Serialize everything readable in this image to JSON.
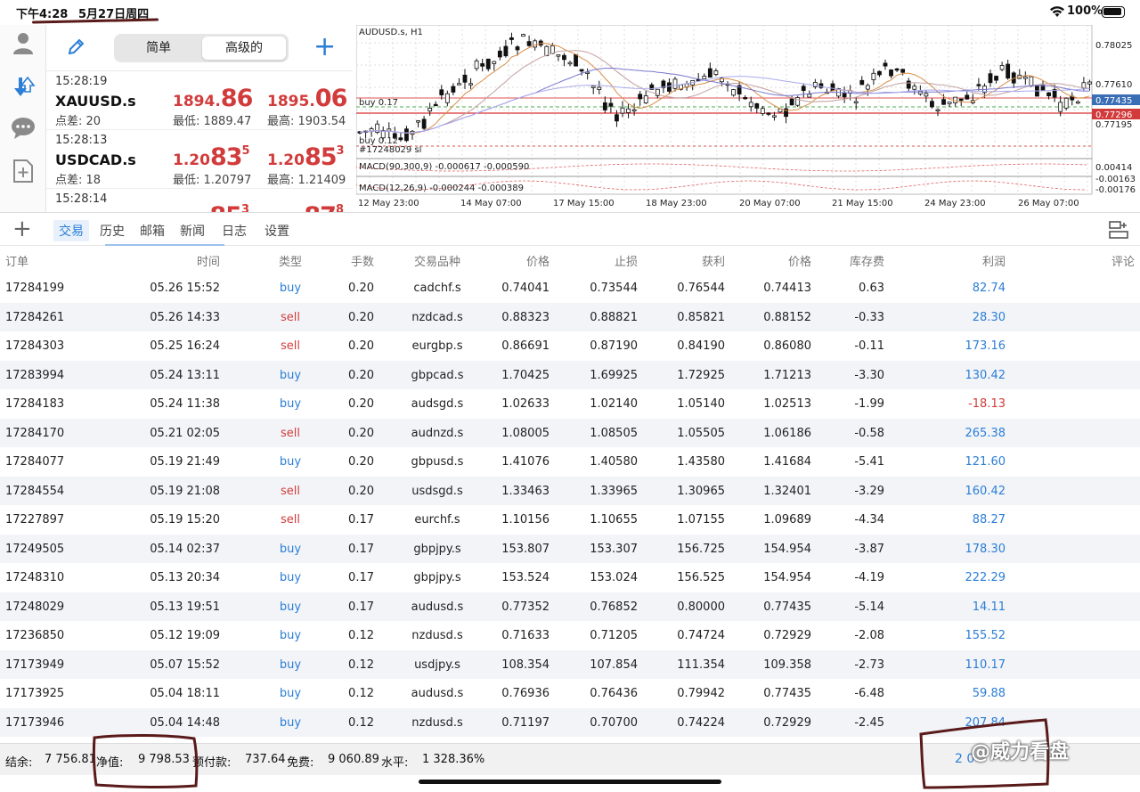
{
  "status": {
    "time": "下午4:28",
    "date": "5月27日周四",
    "battery": "100%"
  },
  "quotes_panel": {
    "segments": [
      "简单",
      "高级的"
    ],
    "active_segment": 1,
    "rows": [
      {
        "time": "15:28:19",
        "symbol": "XAUUSD.s",
        "spread": "点差: 20",
        "bid_pre": "1894.",
        "bid_big": "86",
        "bid_sup": "",
        "ask_pre": "1895.",
        "ask_big": "06",
        "ask_sup": "",
        "low": "最低: 1889.47",
        "high": "最高: 1903.54"
      },
      {
        "time": "15:28:13",
        "symbol": "USDCAD.s",
        "spread": "点差: 18",
        "bid_pre": "1.20",
        "bid_big": "83",
        "bid_sup": "5",
        "ask_pre": "1.20",
        "ask_big": "85",
        "ask_sup": "3",
        "low": "最低: 1.20797",
        "high": "最高: 1.21409"
      },
      {
        "time": "15:28:14",
        "symbol": "",
        "spread": "",
        "bid_pre": "",
        "bid_big": "85",
        "bid_sup": "3",
        "ask_pre": "",
        "ask_big": "87",
        "ask_sup": "8",
        "low": "",
        "high": ""
      }
    ]
  },
  "chart": {
    "symbol": "AUDUSD.s, H1",
    "price_labels": [
      "0.78025",
      "0.77610",
      "0.77435",
      "0.77296",
      "0.77195"
    ],
    "indicator_labels": [
      "0.00414",
      "-0.00163",
      "-0.00176"
    ],
    "time_labels": [
      "12 May 23:00",
      "14 May 07:00",
      "17 May 15:00",
      "18 May 23:00",
      "20 May 07:00",
      "21 May 15:00",
      "24 May 23:00",
      "26 May 07:00"
    ],
    "order_labels": [
      "buy 0.17",
      "buy 0.12",
      "#17248029 sl"
    ],
    "macd1": "MACD(90,300,9) -0.000617 -0.000590",
    "macd2": "MACD(12,26,9) -0.000244 -0.000389"
  },
  "tabs": [
    "交易",
    "历史",
    "邮箱",
    "新闻",
    "日志",
    "设置"
  ],
  "active_tab": 0,
  "table": {
    "headers": [
      "订单",
      "时间",
      "类型",
      "手数",
      "交易品种",
      "价格",
      "止损",
      "获利",
      "价格",
      "库存费",
      "利润",
      "评论"
    ],
    "rows": [
      [
        "17284199",
        "05.26 15:52",
        "buy",
        "0.20",
        "cadchf.s",
        "0.74041",
        "0.73544",
        "0.76544",
        "0.74413",
        "0.63",
        "82.74"
      ],
      [
        "17284261",
        "05.26 14:33",
        "sell",
        "0.20",
        "nzdcad.s",
        "0.88323",
        "0.88821",
        "0.85821",
        "0.88152",
        "-0.33",
        "28.30"
      ],
      [
        "17284303",
        "05.25 16:24",
        "sell",
        "0.20",
        "eurgbp.s",
        "0.86691",
        "0.87190",
        "0.84190",
        "0.86080",
        "-0.11",
        "173.16"
      ],
      [
        "17283994",
        "05.24 13:11",
        "buy",
        "0.20",
        "gbpcad.s",
        "1.70425",
        "1.69925",
        "1.72925",
        "1.71213",
        "-3.30",
        "130.42"
      ],
      [
        "17284183",
        "05.24 11:38",
        "buy",
        "0.20",
        "audsgd.s",
        "1.02633",
        "1.02140",
        "1.05140",
        "1.02513",
        "-1.99",
        "-18.13"
      ],
      [
        "17284170",
        "05.21 02:05",
        "sell",
        "0.20",
        "audnzd.s",
        "1.08005",
        "1.08505",
        "1.05505",
        "1.06186",
        "-0.58",
        "265.38"
      ],
      [
        "17284077",
        "05.19 21:49",
        "buy",
        "0.20",
        "gbpusd.s",
        "1.41076",
        "1.40580",
        "1.43580",
        "1.41684",
        "-5.41",
        "121.60"
      ],
      [
        "17284554",
        "05.19 21:08",
        "sell",
        "0.20",
        "usdsgd.s",
        "1.33463",
        "1.33965",
        "1.30965",
        "1.32401",
        "-3.29",
        "160.42"
      ],
      [
        "17227897",
        "05.19 15:20",
        "sell",
        "0.17",
        "eurchf.s",
        "1.10156",
        "1.10655",
        "1.07155",
        "1.09689",
        "-4.34",
        "88.27"
      ],
      [
        "17249505",
        "05.14 02:37",
        "buy",
        "0.17",
        "gbpjpy.s",
        "153.807",
        "153.307",
        "156.725",
        "154.954",
        "-3.87",
        "178.30"
      ],
      [
        "17248310",
        "05.13 20:34",
        "buy",
        "0.17",
        "gbpjpy.s",
        "153.524",
        "153.024",
        "156.525",
        "154.954",
        "-4.19",
        "222.29"
      ],
      [
        "17248029",
        "05.13 19:51",
        "buy",
        "0.17",
        "audusd.s",
        "0.77352",
        "0.76852",
        "0.80000",
        "0.77435",
        "-5.14",
        "14.11"
      ],
      [
        "17236850",
        "05.12 19:09",
        "buy",
        "0.12",
        "nzdusd.s",
        "0.71633",
        "0.71205",
        "0.74724",
        "0.72929",
        "-2.08",
        "155.52"
      ],
      [
        "17173949",
        "05.07 15:52",
        "buy",
        "0.12",
        "usdjpy.s",
        "108.354",
        "107.854",
        "111.354",
        "109.358",
        "-2.73",
        "110.17"
      ],
      [
        "17173925",
        "05.04 18:11",
        "buy",
        "0.12",
        "audusd.s",
        "0.76936",
        "0.76436",
        "0.79942",
        "0.77435",
        "-6.48",
        "59.88"
      ],
      [
        "17173946",
        "05.04 14:48",
        "buy",
        "0.12",
        "nzdusd.s",
        "0.71197",
        "0.70700",
        "0.74224",
        "0.72929",
        "-2.45",
        "207.84"
      ]
    ]
  },
  "footer": {
    "balance_label": "结余:",
    "balance": "7 756.81",
    "equity_label": "净值:",
    "equity": "9 798.53",
    "margin_label": "预付款:",
    "margin": "737.64",
    "free_label": "免费:",
    "free": "9 060.89",
    "level_label": "水平:",
    "level": "1 328.36%",
    "total_partial": "2 0",
    "watermark": "@威力看盘"
  },
  "colors": {
    "accent": "#2c7ed6",
    "sell": "#d23b3b",
    "annotation": "#5a1a1a"
  }
}
